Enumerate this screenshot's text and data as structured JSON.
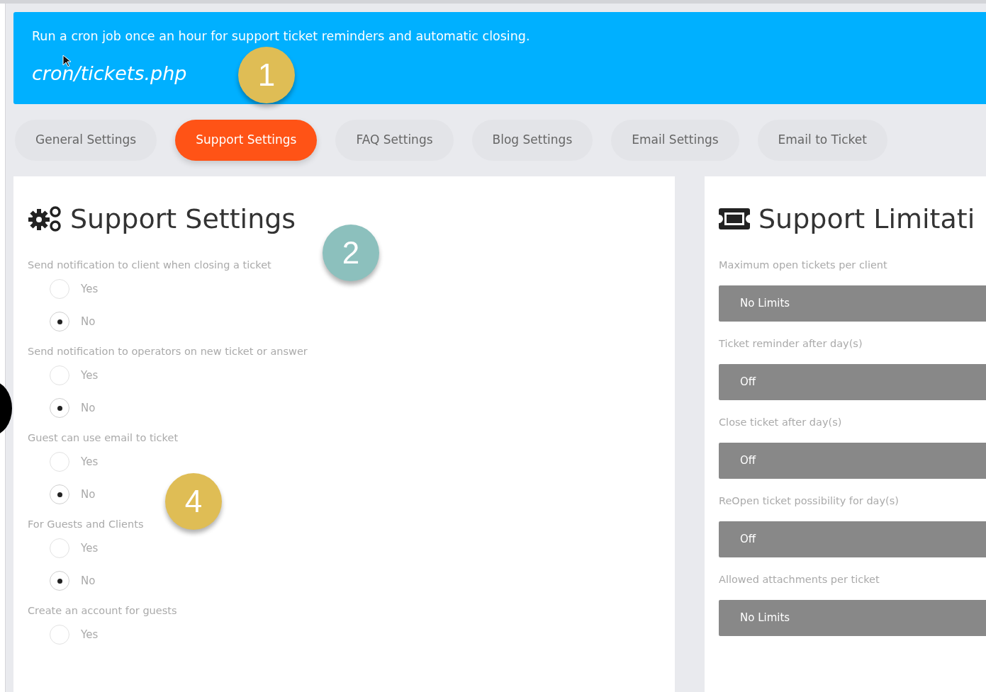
{
  "notice": {
    "text": "Run a cron job once an hour for support ticket reminders and automatic closing.",
    "command": "cron/tickets.php"
  },
  "tabs": [
    {
      "label": "General Settings",
      "selected": false
    },
    {
      "label": "Support Settings",
      "selected": true
    },
    {
      "label": "FAQ Settings",
      "selected": false
    },
    {
      "label": "Blog Settings",
      "selected": false
    },
    {
      "label": "Email Settings",
      "selected": false
    },
    {
      "label": "Email to Ticket",
      "selected": false
    }
  ],
  "settings_panel": {
    "title": "Support Settings",
    "questions": [
      {
        "label": "Send notification to client when closing a ticket",
        "options": [
          {
            "label": "Yes",
            "selected": false
          },
          {
            "label": "No",
            "selected": true
          }
        ]
      },
      {
        "label": "Send notification to operators on new ticket or answer",
        "options": [
          {
            "label": "Yes",
            "selected": false
          },
          {
            "label": "No",
            "selected": true
          }
        ]
      },
      {
        "label": "Guest can use email to ticket",
        "options": [
          {
            "label": "Yes",
            "selected": false
          },
          {
            "label": "No",
            "selected": true
          }
        ]
      },
      {
        "label": "For Guests and Clients",
        "options": [
          {
            "label": "Yes",
            "selected": false
          },
          {
            "label": "No",
            "selected": true
          }
        ]
      },
      {
        "label": "Create an account for guests",
        "options": [
          {
            "label": "Yes",
            "selected": false
          }
        ]
      }
    ]
  },
  "limits_panel": {
    "title": "Support Limitati",
    "fields": [
      {
        "label": "Maximum open tickets per client",
        "value": "No Limits"
      },
      {
        "label": "Ticket reminder after day(s)",
        "value": "Off"
      },
      {
        "label": "Close ticket after day(s)",
        "value": "Off"
      },
      {
        "label": "ReOpen ticket possibility for day(s)",
        "value": "Off"
      },
      {
        "label": "Allowed attachments per ticket",
        "value": "No Limits"
      }
    ]
  },
  "callouts": [
    {
      "label": "1",
      "color": "#dfbd55"
    },
    {
      "label": "2",
      "color": "#8cc0bd"
    },
    {
      "label": "4",
      "color": "#dfbd55"
    }
  ]
}
